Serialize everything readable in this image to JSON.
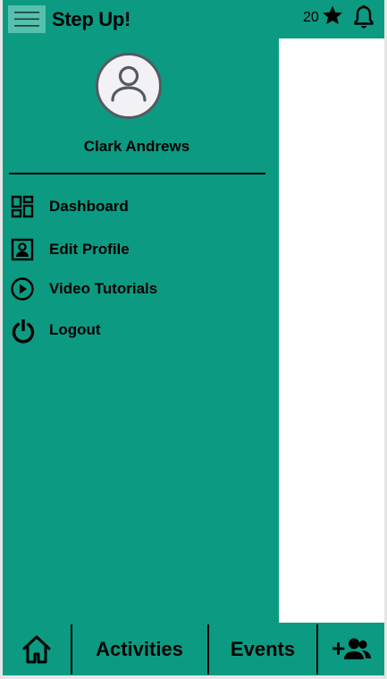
{
  "header": {
    "title": "Step Up!",
    "points": "20",
    "icons": {
      "menu": "hamburger-icon",
      "star": "star-icon",
      "notifications": "bell-icon"
    }
  },
  "drawer": {
    "user_name": "Clark Andrews",
    "avatar_icon": "user-avatar-icon",
    "items": [
      {
        "label": "Dashboard",
        "icon": "dashboard-icon"
      },
      {
        "label": "Edit Profile",
        "icon": "profile-card-icon"
      },
      {
        "label": "Video Tutorials",
        "icon": "play-circle-icon"
      },
      {
        "label": "Logout",
        "icon": "power-icon"
      }
    ]
  },
  "bottom_nav": {
    "home_icon": "home-icon",
    "activities": "Activities",
    "events": "Events",
    "add_friend_icon": "add-friend-icon"
  },
  "colors": {
    "primary": "#0c9a82",
    "menu_button": "#55c0ad",
    "content": "#ffffff"
  }
}
